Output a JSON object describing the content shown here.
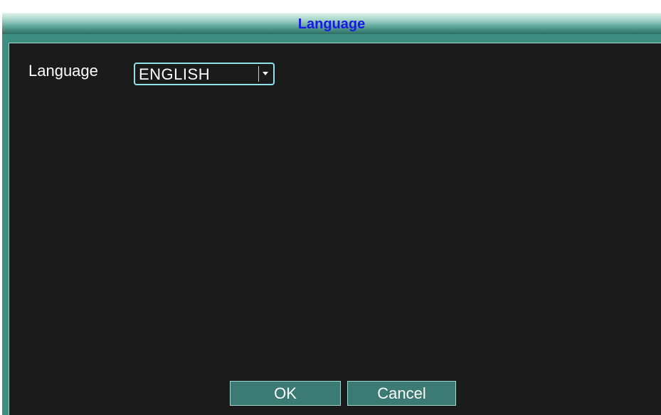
{
  "dialog": {
    "title": "Language"
  },
  "language_setting": {
    "label": "Language",
    "selected_value": "ENGLISH",
    "dropdown_icon": "chevron-down-icon"
  },
  "buttons": {
    "ok_label": "OK",
    "cancel_label": "Cancel"
  },
  "colors": {
    "title_text": "#1a18e6",
    "frame": "#3d8d80",
    "content_background": "#1b1b1b",
    "select_border": "#8fe3ea",
    "button_background": "#3b7b73"
  }
}
